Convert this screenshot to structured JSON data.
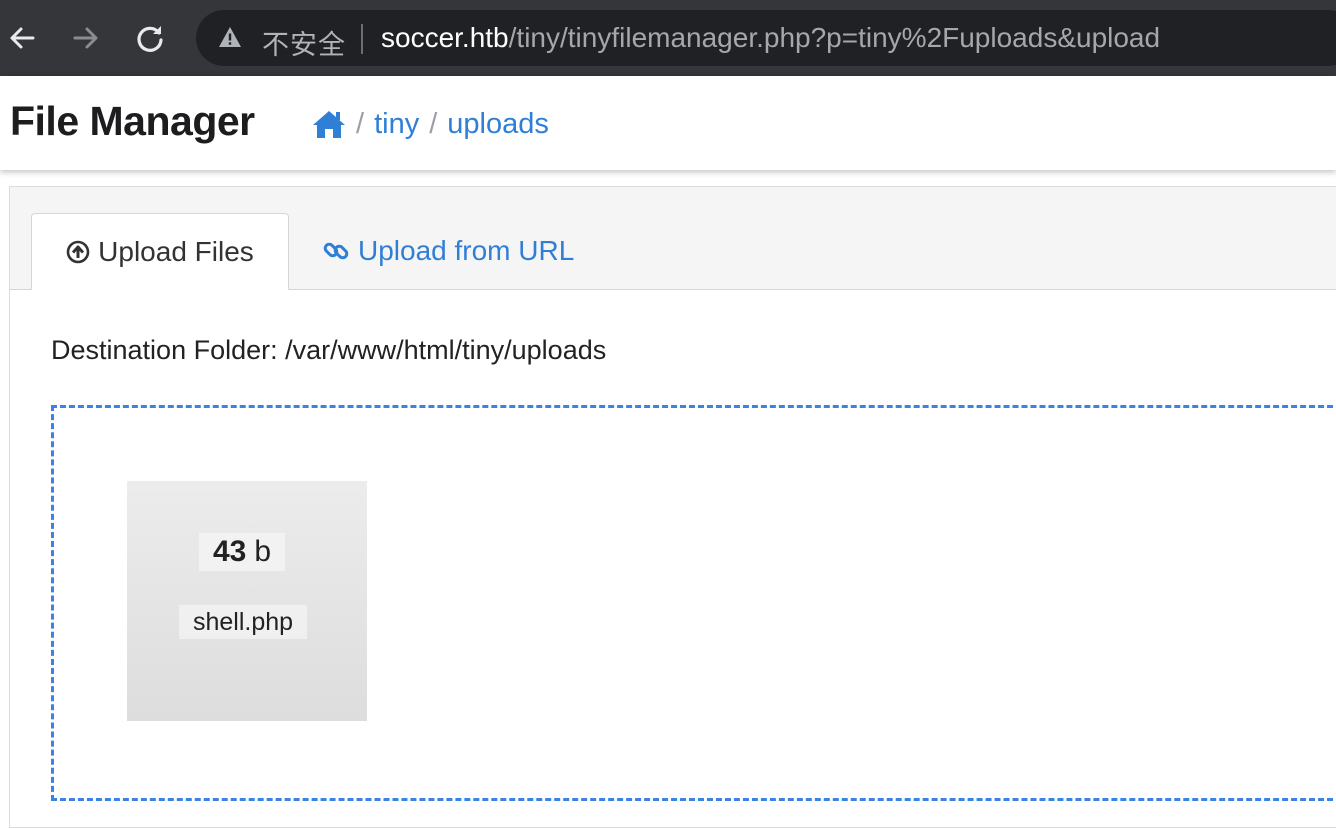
{
  "browser": {
    "security_label": "不安全",
    "url_host": "soccer.htb",
    "url_path": "/tiny/tinyfilemanager.php?p=tiny%2Fuploads&upload",
    "icons": [
      "back-arrow-icon",
      "forward-arrow-icon",
      "reload-icon",
      "warning-icon"
    ]
  },
  "header": {
    "title": "File Manager",
    "breadcrumb": [
      {
        "label": "tiny"
      },
      {
        "label": "uploads"
      }
    ],
    "breadcrumb_separator": "/",
    "accent_color": "#2f7fd6"
  },
  "tabs": [
    {
      "label": "Upload Files",
      "icon": "arrow-circle-up-icon",
      "active": true
    },
    {
      "label": "Upload from URL",
      "icon": "link-icon",
      "active": false
    }
  ],
  "upload": {
    "destination_label": "Destination Folder: /var/www/html/tiny/uploads",
    "dropzone_border_color": "#3b82e6",
    "files": [
      {
        "size_value": "43",
        "size_unit": "b",
        "name": "shell.php"
      }
    ]
  }
}
